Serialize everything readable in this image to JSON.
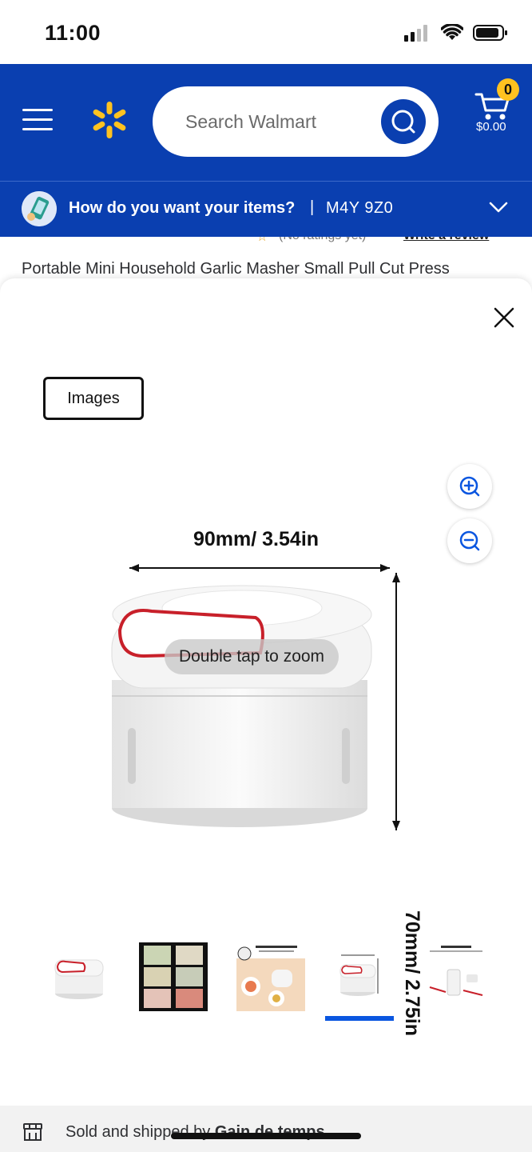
{
  "status_bar": {
    "time": "11:00",
    "icons": [
      "signal-icon",
      "wifi-icon",
      "battery-icon"
    ]
  },
  "header": {
    "search_placeholder": "Search Walmart",
    "cart_count": "0",
    "cart_total": "$0.00",
    "brand_color": "#0a3fb0",
    "accent_color": "#ffc220"
  },
  "delivery": {
    "question": "How do you want your items?",
    "separator": "|",
    "postal_code": "M4Y 9Z0"
  },
  "product": {
    "title": "Portable Mini Household Garlic Masher Small Pull Cut Press",
    "ratings_text": "(No ratings yet)",
    "write_review": "Write a review"
  },
  "modal": {
    "tab_label": "Images",
    "zoom_hint": "Double tap to zoom",
    "dimension_width": "90mm/ 3.54in",
    "dimension_height": "70mm/ 2.75in",
    "thumbnails": [
      {
        "name": "thumb-product-front",
        "selected": false
      },
      {
        "name": "thumb-chopped-vegetables-grid",
        "selected": false
      },
      {
        "name": "thumb-food-grade-steel",
        "selected": false,
        "caption": "Food grade stainless steel"
      },
      {
        "name": "thumb-dimensions",
        "selected": true
      },
      {
        "name": "thumb-cycle-smash",
        "selected": false,
        "caption": "Cycle smash"
      }
    ],
    "selected_thumbnail_index": 3
  },
  "seller": {
    "prefix": "Sold and shipped by ",
    "name": "Gain de temps"
  }
}
